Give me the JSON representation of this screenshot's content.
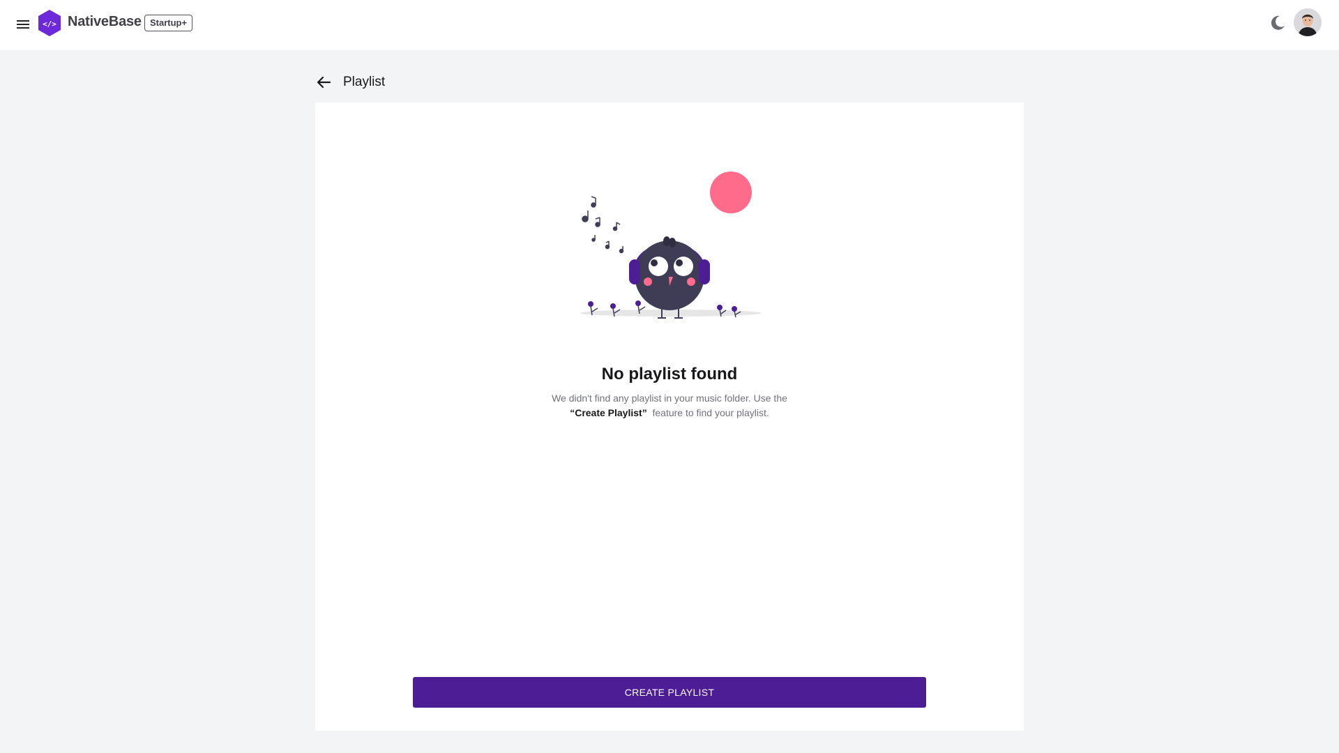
{
  "header": {
    "brand": "NativeBase",
    "badge": "Startup+",
    "icons": [
      "menu-icon",
      "code-icon",
      "moon-icon",
      "avatar"
    ]
  },
  "page": {
    "title": "Playlist",
    "back_icon": "arrow-left-icon"
  },
  "empty_state": {
    "title": "No playlist found",
    "desc_before": "We didn't find any playlist in your music folder. Use the ",
    "desc_highlight": "“Create Playlist”",
    "desc_after": "  feature to find your playlist."
  },
  "actions": {
    "create_label": "CREATE PLAYLIST"
  },
  "colors": {
    "primary": "#4c1d95",
    "logo": "#6d28d9",
    "accent_pink": "#ff6b8b",
    "bird_body": "#3f3d56",
    "background": "#f3f4f6"
  }
}
